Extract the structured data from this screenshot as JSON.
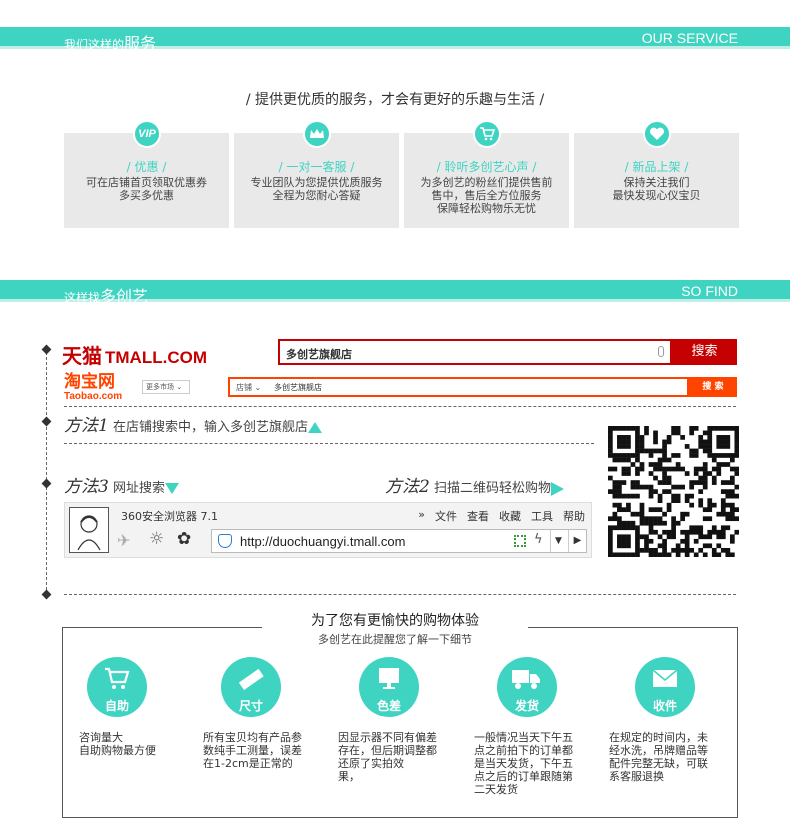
{
  "service_band": {
    "cn_prefix": "我们这样的",
    "cn_big": "服务",
    "en": "OUR SERVICE"
  },
  "slogan": "/ 提供更优质的服务，才会有更好的乐趣与生活 /",
  "service_cards": [
    {
      "icon": "VIP",
      "title": "/ 优惠 /",
      "lines": [
        "可在店铺首页领取优惠券",
        "多买多优惠"
      ]
    },
    {
      "icon": "crown-icon",
      "title": "/ 一对一客服 /",
      "lines": [
        "专业团队为您提供优质服务",
        "全程为您耐心答疑"
      ]
    },
    {
      "icon": "cart-icon",
      "title": "/ 聆听多创艺心声 /",
      "lines": [
        "为多创艺的粉丝们提供售前",
        "售中，售后全方位服务",
        "保障轻松购物乐无忧"
      ]
    },
    {
      "icon": "heart-icon",
      "title": "/ 新品上架 /",
      "lines": [
        "保持关注我们",
        "最快发现心仪宝贝"
      ]
    }
  ],
  "find_band": {
    "cn_prefix": "这样找",
    "cn_big": "多创艺",
    "en": "SO FIND"
  },
  "tmall": {
    "logo_cn": "天猫",
    "logo_en": "TMALL.COM",
    "query": "多创艺旗舰店",
    "button": "搜索"
  },
  "taobao": {
    "logo_cn": "淘宝网",
    "logo_en": "Taobao.com",
    "market": "更多市场",
    "scope": "店铺",
    "query": "多创艺旗舰店",
    "button": "搜 索"
  },
  "method1": {
    "name": "方法1",
    "text": "在店铺搜索中，输入多创艺旗舰店"
  },
  "method2": {
    "name": "方法2",
    "text": "扫描二维码轻松购物"
  },
  "method3": {
    "name": "方法3",
    "text": "网址搜索"
  },
  "browser": {
    "title": "360安全浏览器 7.1",
    "menu": [
      "»",
      "文件",
      "查看",
      "收藏",
      "工具",
      "帮助"
    ],
    "url": "http://duochuangyi.tmall.com"
  },
  "details": {
    "title": "为了您有更愉快的购物体验",
    "subtitle": "多创艺在此提醒您了解一下细节",
    "items": [
      {
        "label": "自助",
        "lines": [
          "咨询量大",
          "自助购物最方便"
        ]
      },
      {
        "label": "尺寸",
        "lines": [
          "所有宝贝均有产品参",
          "数纯手工测量，误差",
          "在1-2cm是正常的"
        ]
      },
      {
        "label": "色差",
        "lines": [
          "因显示器不同有偏差",
          "存在，但后期调整都",
          "还原了实拍效",
          "果，"
        ]
      },
      {
        "label": "发货",
        "lines": [
          "一般情况当天下午五",
          "点之前拍下的订单都",
          "是当天发货，下午五",
          "点之后的订单跟随第",
          "二天发货"
        ]
      },
      {
        "label": "收件",
        "lines": [
          "在规定的时间内，未",
          "经水洗，吊牌赠品等",
          "配件完整无缺，可联",
          "系客服退换"
        ]
      }
    ]
  },
  "colors": {
    "accent": "#3fd4c2",
    "tmall_red": "#c40000",
    "taobao_orange": "#f40"
  }
}
